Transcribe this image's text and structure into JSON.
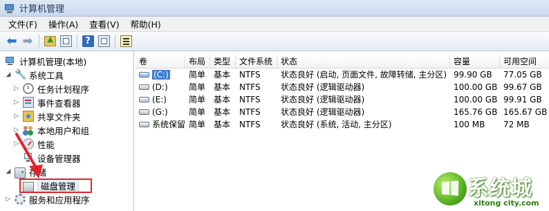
{
  "window": {
    "title": "计算机管理"
  },
  "menu": [
    "文件(F)",
    "操作(A)",
    "查看(V)",
    "帮助(H)"
  ],
  "toolbar": {
    "icons": [
      "back-arrow-icon",
      "forward-arrow-icon",
      "up-folder-icon",
      "show-hide-tree-icon",
      "help-icon",
      "show-action-pane-icon",
      "properties-icon"
    ]
  },
  "tree": {
    "root": "计算机管理(本地)",
    "system_tools": "系统工具",
    "task_scheduler": "任务计划程序",
    "event_viewer": "事件查看器",
    "shared_folders": "共享文件夹",
    "local_users": "本地用户和组",
    "performance": "性能",
    "device_manager": "设备管理器",
    "storage": "存储",
    "disk_management": "磁盘管理",
    "services_apps": "服务和应用程序"
  },
  "columns": [
    "卷",
    "布局",
    "类型",
    "文件系统",
    "状态",
    "容量",
    "可用空间"
  ],
  "volumes": [
    {
      "name": "(C:)",
      "layout": "简单",
      "type": "基本",
      "fs": "NTFS",
      "status": "状态良好 (启动, 页面文件, 故障转储, 主分区)",
      "capacity": "99.90 GB",
      "free": "77.05 GB"
    },
    {
      "name": "(D:)",
      "layout": "简单",
      "type": "基本",
      "fs": "NTFS",
      "status": "状态良好 (逻辑驱动器)",
      "capacity": "100.00 GB",
      "free": "99.67 GB"
    },
    {
      "name": "(E:)",
      "layout": "简单",
      "type": "基本",
      "fs": "NTFS",
      "status": "状态良好 (逻辑驱动器)",
      "capacity": "100.00 GB",
      "free": "99.91 GB"
    },
    {
      "name": "(G:)",
      "layout": "简单",
      "type": "基本",
      "fs": "NTFS",
      "status": "状态良好 (逻辑驱动器)",
      "capacity": "165.76 GB",
      "free": "165.67 GB"
    },
    {
      "name": "系统保留",
      "layout": "简单",
      "type": "基本",
      "fs": "NTFS",
      "status": "状态良好 (系统, 活动, 主分区)",
      "capacity": "100 MB",
      "free": "72 MB"
    }
  ],
  "watermark": {
    "text": "系统城",
    "sub": "xitong city.com"
  },
  "colors": {
    "highlight_box": "#e0232b",
    "selection": "#3a7ed3",
    "watermark_green": "#49a418"
  }
}
